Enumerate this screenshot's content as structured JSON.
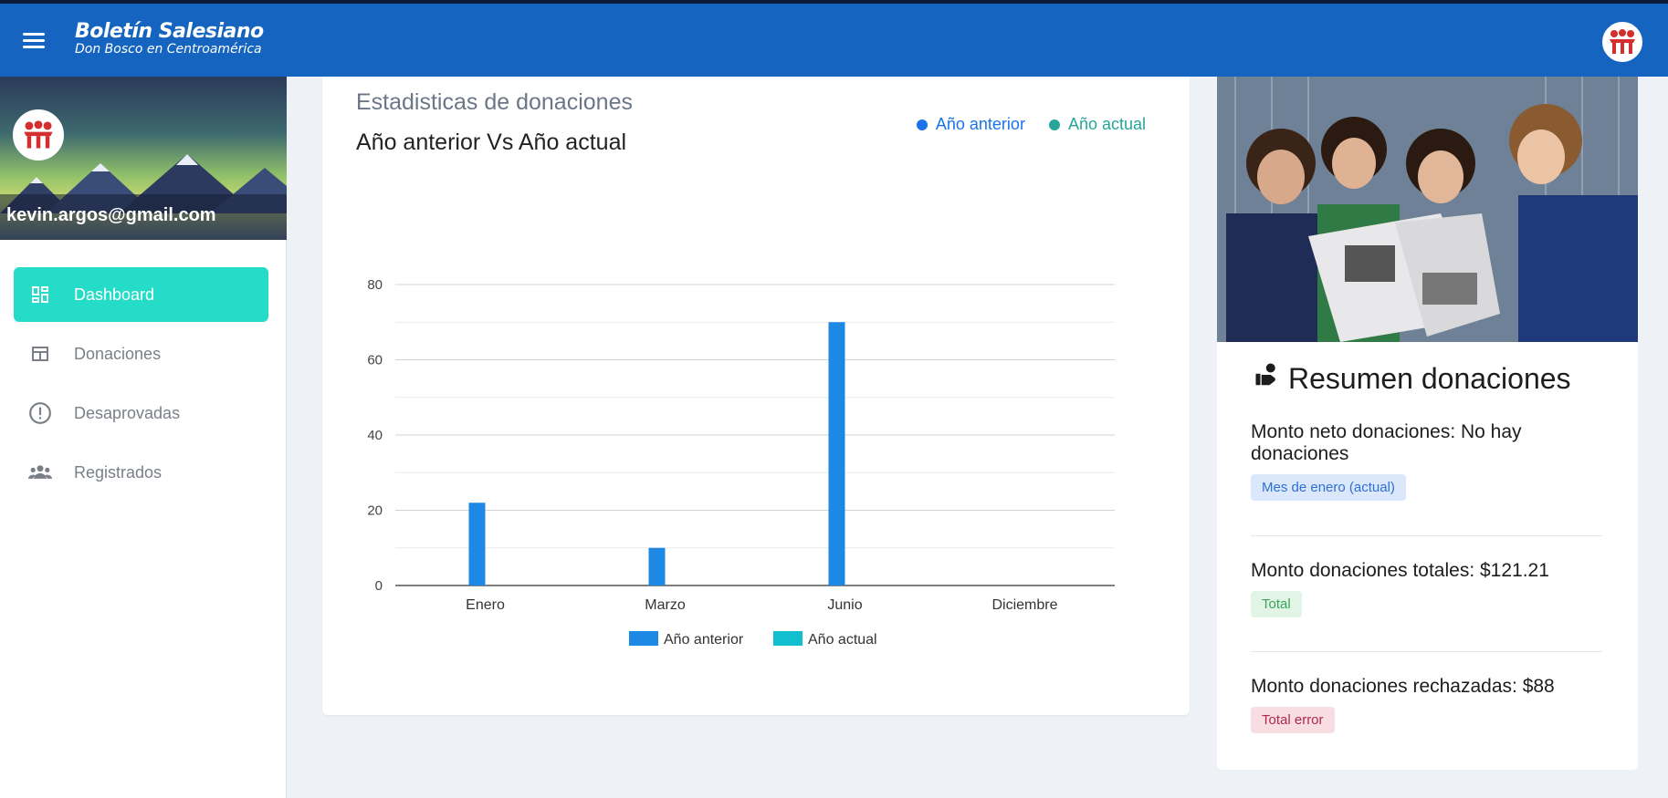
{
  "header": {
    "brand_title": "Boletín Salesiano",
    "brand_subtitle": "Don Bosco en Centroamérica"
  },
  "sidebar": {
    "email": "kevin.argos@gmail.com",
    "items": [
      {
        "label": "Dashboard",
        "icon": "dashboard-icon",
        "active": true
      },
      {
        "label": "Donaciones",
        "icon": "table-icon",
        "active": false
      },
      {
        "label": "Desaprovadas",
        "icon": "alert-circle-icon",
        "active": false
      },
      {
        "label": "Registrados",
        "icon": "people-icon",
        "active": false
      }
    ]
  },
  "chart_card": {
    "title": "Estadisticas de donaciones",
    "subtitle": "Año anterior Vs Año actual",
    "top_legend": [
      {
        "label": "Año anterior",
        "color": "#1a73e8"
      },
      {
        "label": "Año actual",
        "color": "#26a69a"
      }
    ]
  },
  "chart_data": {
    "type": "bar",
    "categories": [
      "Enero",
      "Marzo",
      "Junio",
      "Diciembre"
    ],
    "series": [
      {
        "name": "Año anterior",
        "values": [
          22,
          10,
          70,
          0
        ],
        "color": "#1e88e5"
      },
      {
        "name": "Año actual",
        "values": [
          0,
          0,
          0,
          0
        ],
        "color": "#12bfcf"
      }
    ],
    "ylim": [
      0,
      80
    ],
    "yticks": [
      0,
      20,
      40,
      60,
      80
    ],
    "grid": true,
    "legend": "bottom"
  },
  "summary": {
    "title": "Resumen donaciones",
    "blocks": [
      {
        "label": "Monto neto donaciones: No hay donaciones",
        "badge": "Mes de enero (actual)"
      },
      {
        "label": "Monto donaciones totales: $121.21",
        "badge": "Total"
      },
      {
        "label": "Monto donaciones rechazadas: $88",
        "badge": "Total error"
      }
    ]
  },
  "colors": {
    "topbar": "#1565c0",
    "accent": "#24dcc7"
  }
}
